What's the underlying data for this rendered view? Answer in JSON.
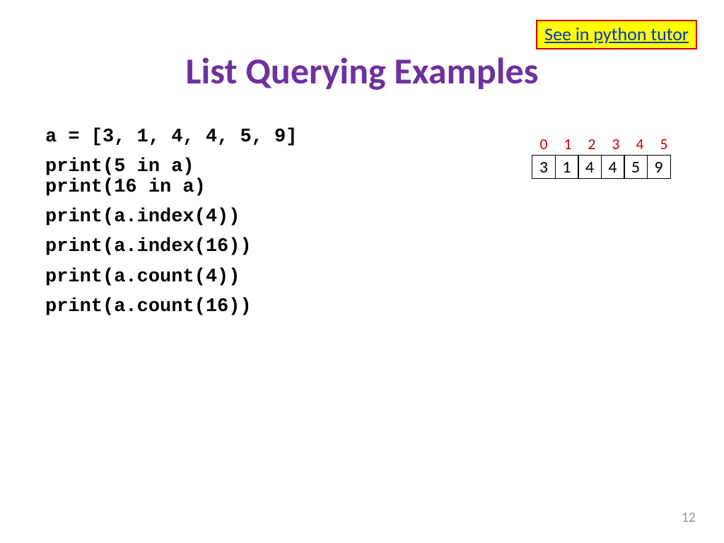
{
  "link": {
    "label": "See in python tutor"
  },
  "title": "List Querying Examples",
  "code": {
    "l1": "a = [3, 1, 4, 4, 5, 9]",
    "l2": "print(5 in a)",
    "l3": "print(16 in a)",
    "l4": "print(a.index(4))",
    "l5": "print(a.index(16))",
    "l6": "print(a.count(4))",
    "l7": "print(a.count(16))"
  },
  "array": {
    "indices": [
      "0",
      "1",
      "2",
      "3",
      "4",
      "5"
    ],
    "values": [
      "3",
      "1",
      "4",
      "4",
      "5",
      "9"
    ]
  },
  "page": "12"
}
